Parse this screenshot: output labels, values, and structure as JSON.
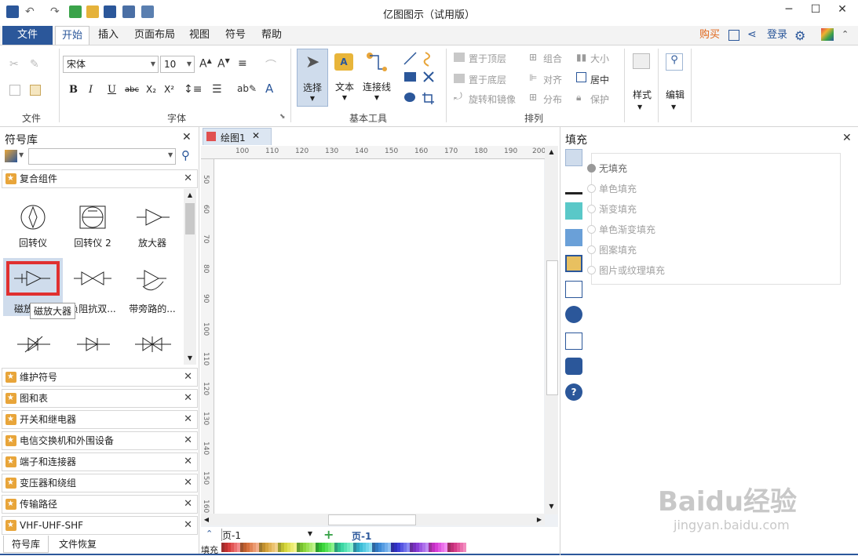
{
  "window": {
    "title": "亿图图示（试用版）",
    "controls": [
      "─",
      "☐",
      "✕"
    ]
  },
  "menu": {
    "file": "文件",
    "tabs": [
      "开始",
      "插入",
      "页面布局",
      "视图",
      "符号",
      "帮助"
    ],
    "active_tab": "开始",
    "right": {
      "buy": "购买",
      "login": "登录"
    }
  },
  "ribbon": {
    "file_group": {
      "label": "文件"
    },
    "font_group": {
      "label": "字体",
      "font_name": "宋体",
      "font_size": "10",
      "bold": "B",
      "italic": "I",
      "underline": "U",
      "strike": "abc",
      "subscript": "X₂",
      "superscript": "X²"
    },
    "basic_tools": {
      "label": "基本工具",
      "select": "选择",
      "text": "文本",
      "connector": "连接线"
    },
    "arrange": {
      "label": "排列",
      "bring_to_front": "置于顶层",
      "send_to_back": "置于底层",
      "rotate_mirror": "旋转和镜像",
      "group": "组合",
      "align": "对齐",
      "distribute": "分布",
      "size": "大小",
      "center": "居中",
      "protect": "保护"
    },
    "style": {
      "label": "样式"
    },
    "edit": {
      "label": "编辑"
    }
  },
  "symbol_library": {
    "title": "符号库",
    "search_placeholder": "",
    "open_category": "复合组件",
    "shapes": [
      {
        "label": "回转仪",
        "icon": "gyro-icon"
      },
      {
        "label": "回转仪 2",
        "icon": "gyro2-icon"
      },
      {
        "label": "放大器",
        "icon": "amplifier-icon"
      },
      {
        "label": "磁放大器",
        "icon": "magnetic-amplifier-icon",
        "selected": true
      },
      {
        "label": "负阻抗双...",
        "icon": "negative-impedance-icon"
      },
      {
        "label": "带旁路的...",
        "icon": "bypass-icon"
      }
    ],
    "tooltip": "磁放大器",
    "categories": [
      "维护符号",
      "图和表",
      "开关和继电器",
      "电信交换机和外围设备",
      "端子和连接器",
      "变压器和绕组",
      "传输路径",
      "VHF-UHF-SHF"
    ],
    "bottom_tabs": [
      "符号库",
      "文件恢复"
    ]
  },
  "document": {
    "tab": "绘图1",
    "ruler_h": [
      "100",
      "110",
      "120",
      "130",
      "140",
      "150",
      "160",
      "170",
      "180",
      "190",
      "200"
    ],
    "ruler_v": [
      "50",
      "60",
      "70",
      "80",
      "90",
      "100",
      "110",
      "120",
      "130",
      "140",
      "150",
      "160"
    ],
    "page_selector": "页-1",
    "page_tab": "页-1",
    "fill_label": "填充"
  },
  "fill_panel": {
    "title": "填充",
    "options": [
      "无填充",
      "单色填充",
      "渐变填充",
      "单色渐变填充",
      "图案填充",
      "图片或纹理填充"
    ],
    "selected": "无填充"
  },
  "watermark": {
    "text": "Baidu经验",
    "url": "jingyan.baidu.com"
  },
  "colors": {
    "accent": "#2b579a",
    "highlight": "#e03030",
    "buy": "#e0661a"
  }
}
